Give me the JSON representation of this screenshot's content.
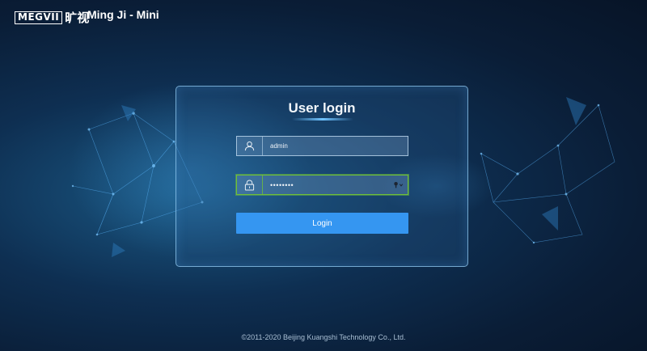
{
  "header": {
    "logo_text": "MEGVII",
    "logo_cn": "旷视",
    "app_title": "Ming Ji - Mini"
  },
  "login": {
    "title": "User login",
    "username_value": "admin",
    "password_value": "••••••••",
    "login_label": "Login",
    "icons": {
      "username": "user-icon",
      "password": "lock-icon",
      "password_manager": "key-icon"
    }
  },
  "footer": {
    "copyright": "©2011-2020    Beijing Kuangshi Technology Co., Ltd."
  },
  "colors": {
    "accent_button": "#3596f1",
    "focus_border": "#6fbf3a",
    "background_dark": "#0a1d36"
  }
}
